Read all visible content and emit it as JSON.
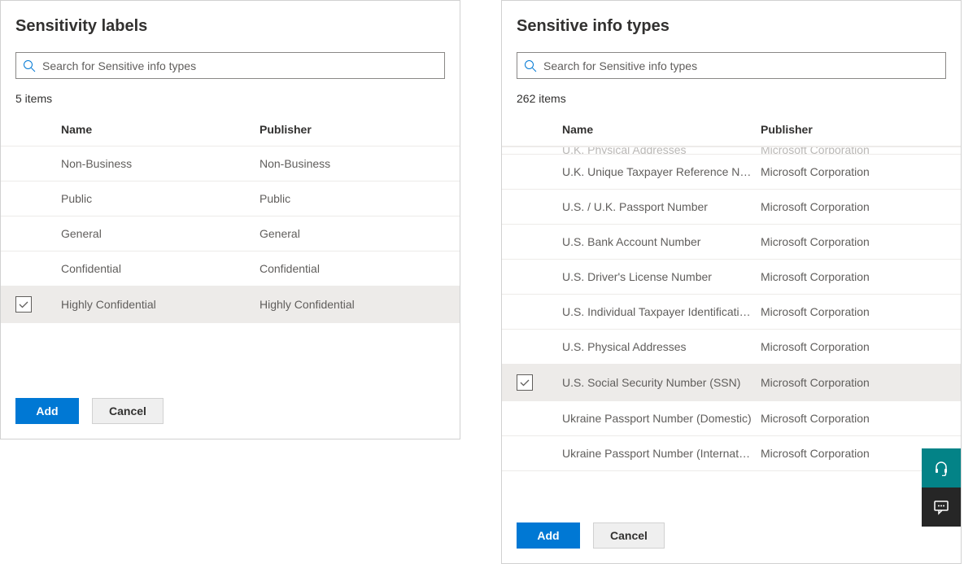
{
  "left_panel": {
    "title": "Sensitivity labels",
    "search_placeholder": "Search for Sensitive info types",
    "item_count": "5 items",
    "columns": {
      "name": "Name",
      "publisher": "Publisher"
    },
    "rows": [
      {
        "name": "Non-Business",
        "publisher": "Non-Business",
        "selected": false
      },
      {
        "name": "Public",
        "publisher": "Public",
        "selected": false
      },
      {
        "name": "General",
        "publisher": "General",
        "selected": false
      },
      {
        "name": "Confidential",
        "publisher": "Confidential",
        "selected": false
      },
      {
        "name": "Highly Confidential",
        "publisher": "Highly Confidential",
        "selected": true
      }
    ],
    "buttons": {
      "add": "Add",
      "cancel": "Cancel"
    }
  },
  "right_panel": {
    "title": "Sensitive info types",
    "search_placeholder": "Search for Sensitive info types",
    "item_count": "262 items",
    "columns": {
      "name": "Name",
      "publisher": "Publisher"
    },
    "cut_off_row": {
      "name": "U.K. Physical Addresses",
      "publisher": "Microsoft Corporation"
    },
    "rows": [
      {
        "name": "U.K. Unique Taxpayer Reference Number",
        "publisher": "Microsoft Corporation",
        "selected": false
      },
      {
        "name": "U.S. / U.K. Passport Number",
        "publisher": "Microsoft Corporation",
        "selected": false
      },
      {
        "name": "U.S. Bank Account Number",
        "publisher": "Microsoft Corporation",
        "selected": false
      },
      {
        "name": "U.S. Driver's License Number",
        "publisher": "Microsoft Corporation",
        "selected": false
      },
      {
        "name": "U.S. Individual Taxpayer Identification Number (ITIN)",
        "publisher": "Microsoft Corporation",
        "selected": false
      },
      {
        "name": "U.S. Physical Addresses",
        "publisher": "Microsoft Corporation",
        "selected": false
      },
      {
        "name": "U.S. Social Security Number (SSN)",
        "publisher": "Microsoft Corporation",
        "selected": true
      },
      {
        "name": "Ukraine Passport Number (Domestic)",
        "publisher": "Microsoft Corporation",
        "selected": false
      },
      {
        "name": "Ukraine Passport Number (International)",
        "publisher": "Microsoft Corporation",
        "selected": false
      }
    ],
    "buttons": {
      "add": "Add",
      "cancel": "Cancel"
    }
  }
}
